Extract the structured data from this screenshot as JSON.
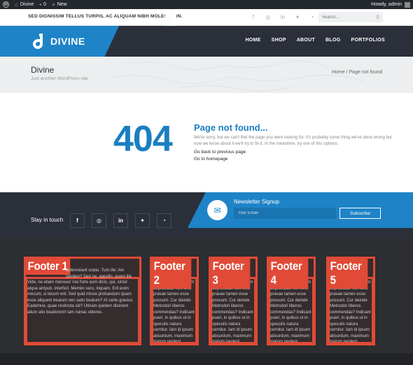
{
  "admin_bar": {
    "site_name": "Divine",
    "comments_count": "0",
    "new_label": "New",
    "howdy": "Howdy, admin"
  },
  "top_strip": {
    "tagline": "SED DIGNISSIM TELLUS TURPIS, AC ALIQUAM NIBH MOLESTIE IN.",
    "social_icons": [
      "facebook-icon",
      "dribbble-icon",
      "linkedin-icon",
      "twitter-icon",
      "rss-icon"
    ],
    "search_placeholder": "Search..."
  },
  "header": {
    "logo_text": "DIVINE",
    "nav": [
      "HOME",
      "SHOP",
      "ABOUT",
      "BLOG",
      "PORTFOLIOS"
    ],
    "colors": {
      "brand_blue": "#1e83c7",
      "dark": "#2b2f3a"
    }
  },
  "title_area": {
    "title": "Divine",
    "subtitle": "Just another WordPress site",
    "breadcrumb": "Home / Page not found"
  },
  "not_found": {
    "code": "404",
    "heading": "Page not found...",
    "message": "We're sorry, but we can't find the page you were looking for. It's probably some thing we've done wrong but now we know about it we'll try to fix it. In the meantime, try one of this options:",
    "link_back": "Go back to previous page",
    "link_home": "Go to homepage"
  },
  "newsletter": {
    "stay_in_touch": "Stay in touch",
    "social_icons": [
      "facebook-icon",
      "dribbble-icon",
      "linkedin-icon",
      "twitter-icon",
      "rss-icon"
    ],
    "title": "Newsletter Signup",
    "email_placeholder": "Your Email",
    "subscribe_label": "Subscribe"
  },
  "footer": {
    "widgets": [
      {
        "title": "Footer 1",
        "text": "Vide, ne etiam menses! nisi forte eum dicis, qui, simul atque arripuit, interficit. Memini vero, inquam. Erit enim mecum, si tecum erit. Sed quid minus probandum quam esse aliquem beatum nec satis beatum? At certe gravius. Eademne, quae restincta siti? Utinam quidem dicerent alium alio beatiorem! Iam ruinas videres."
      },
      {
        "title": "Footer 2",
        "text": "dolore; Quamvis enim depravatae non sint, pravae tamen esse possunt. Cur deinde Metrodori liberos commendas? Indicant pueri, in quibus ut in speculis natura cernitur. Iam id ipsum absurdum, maximum malum neglegi."
      },
      {
        "title": "Footer 3",
        "text": "dolore; Quamvis enim depravatae non sint, pravae tamen esse possunt. Cur deinde Metrodori liberos commendas? Indicant pueri, in quibus ut in speculis natura cernitur. Iam id ipsum absurdum, maximum malum neglegi."
      },
      {
        "title": "Footer 4",
        "text": "dolore; Quamvis enim depravatae non sint, pravae tamen esse possunt. Cur deinde Metrodori liberos commendas? Indicant pueri, in quibus ut in speculis natura cernitur. Iam id ipsum absurdum, maximum malum neglegi."
      },
      {
        "title": "Footer 5",
        "text": "dolore; Quamvis enim depravatae non sint, pravae tamen esse possunt. Cur deinde Metrodori liberos commendas? Indicant pueri, in quibus ut in speculis natura cernitur. Iam id ipsum absurdum, maximum malum neglegi."
      }
    ],
    "first_line": "aetervolavit oratio. Tum ille: Ain tandem? Sed ne, appello, quem ille unum secutus est"
  }
}
